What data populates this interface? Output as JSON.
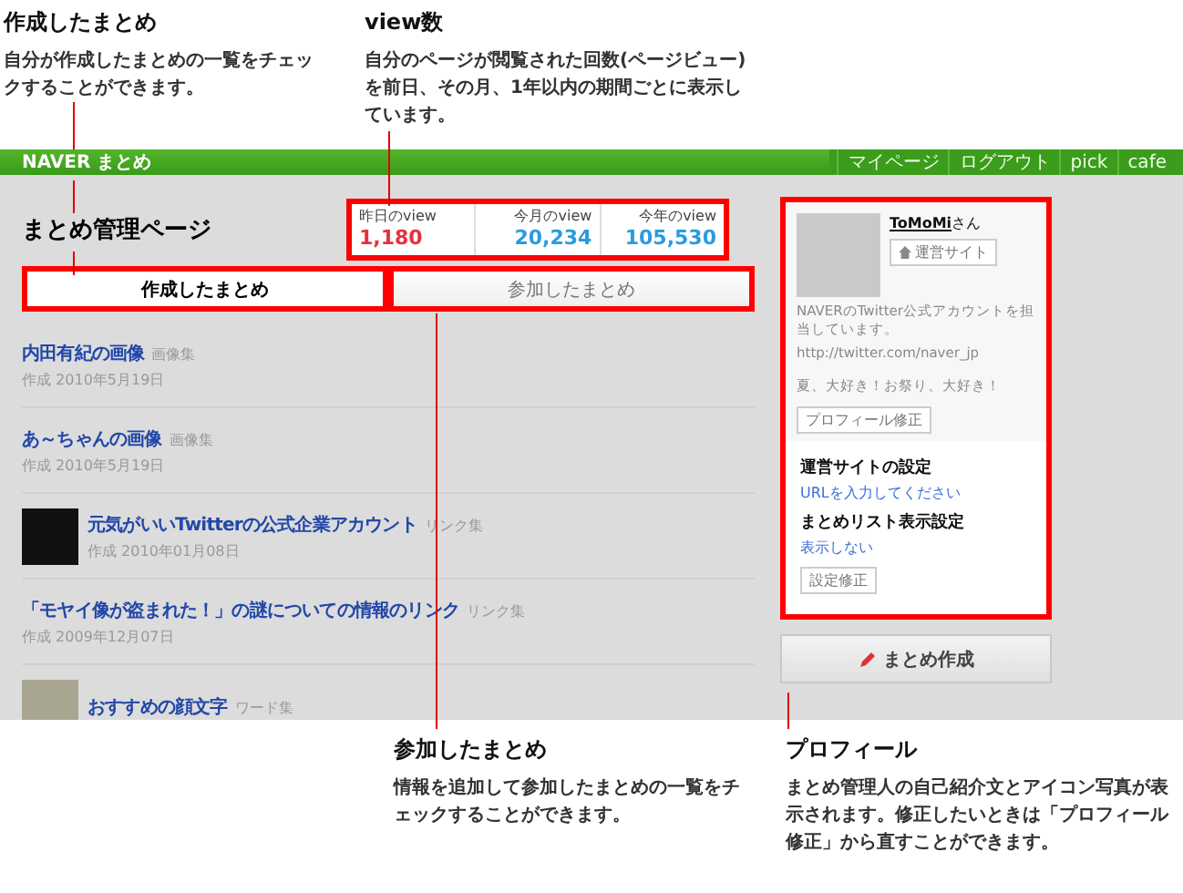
{
  "annotations_top": [
    {
      "title": "作成したまとめ",
      "text": "自分が作成したまとめの一覧をチェックすることができます。"
    },
    {
      "title": "view数",
      "text": "自分のページが閲覧された回数(ページビュー)を前日、その月、1年以内の期間ごとに表示しています。"
    }
  ],
  "screen": {
    "header": {
      "logo": "NAVER まとめ",
      "nav": [
        "マイページ",
        "ログアウト",
        "pick",
        "cafe"
      ]
    },
    "page_title": "まとめ管理ページ",
    "stats": [
      {
        "label": "昨日のview",
        "value": "1,180",
        "color": "#e8303a"
      },
      {
        "label": "今月のview",
        "value": "20,234",
        "color": "#2a9be0"
      },
      {
        "label": "今年のview",
        "value": "105,530",
        "color": "#2a9be0"
      }
    ],
    "tabs": [
      {
        "label": "作成したまとめ",
        "selected": true
      },
      {
        "label": "参加したまとめ",
        "selected": false
      }
    ],
    "items": [
      {
        "kind": "plain",
        "title": "内田有紀の画像",
        "category": "画像集",
        "date": "作成 2010年5月19日"
      },
      {
        "kind": "plain",
        "title": "あ～ちゃんの画像",
        "category": "画像集",
        "date": "作成 2010年5月19日"
      },
      {
        "kind": "thumb",
        "title": "元気がいいTwitterの公式企業アカウント",
        "category": "リンク集",
        "date": "作成 2010年01月08日"
      },
      {
        "kind": "plain",
        "title": "「モヤイ像が盗まれた！」の謎についての情報のリンク",
        "category": "リンク集",
        "date": "作成 2009年12月07日"
      },
      {
        "kind": "thumb",
        "title": "おすすめの顔文字",
        "category": "ワード集"
      }
    ],
    "profile": {
      "name": "ToMoMi",
      "honorific": "さん",
      "site_button": "運営サイト",
      "bio": [
        "NAVERのTwitter公式アカウントを担当しています。",
        "http://twitter.com/naver_jp",
        "夏、大好き！お祭り、大好き！"
      ],
      "edit_button": "プロフィール修正",
      "settings": [
        {
          "heading": "運営サイトの設定",
          "value": "URLを入力してください"
        },
        {
          "heading": "まとめリスト表示設定",
          "value": "表示しない"
        }
      ],
      "settings_button": "設定修正"
    },
    "create_button": "まとめ作成"
  },
  "annotations_bottom": [
    {
      "title": "参加したまとめ",
      "text": "情報を追加して参加したまとめの一覧をチェックすることができます。"
    },
    {
      "title": "プロフィール",
      "text": "まとめ管理人の自己紹介文とアイコン写真が表示されます。修正したいときは「プロフィール修正」から直すことができます。"
    }
  ]
}
